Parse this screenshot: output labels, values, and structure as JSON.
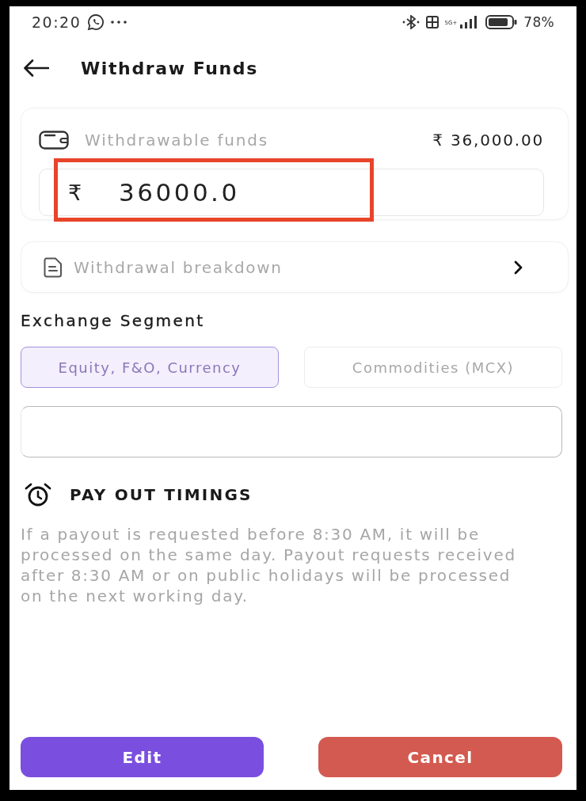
{
  "status_bar": {
    "time": "20:20",
    "network": "5G+",
    "battery": "78%"
  },
  "header": {
    "title": "Withdraw Funds"
  },
  "funds_card": {
    "label": "Withdrawable funds",
    "available": "₹ 36,000.00",
    "amount_field": {
      "currency": "₹",
      "value": "36000.0",
      "highlighted": true
    }
  },
  "breakdown": {
    "label": "Withdrawal breakdown"
  },
  "exchange_segment": {
    "title": "Exchange Segment",
    "options": [
      {
        "label": "Equity, F&O, Currency",
        "selected": true
      },
      {
        "label": "Commodities (MCX)",
        "selected": false
      }
    ]
  },
  "payout": {
    "title": "PAY OUT TIMINGS",
    "text": "If a payout is requested before 8:30 AM, it will be processed on the same day. Payout requests received after 8:30 AM or on public holidays will be processed on the next working day."
  },
  "buttons": [
    {
      "label": "Edit",
      "kind": "primary"
    },
    {
      "label": "Cancel",
      "kind": "danger"
    }
  ]
}
